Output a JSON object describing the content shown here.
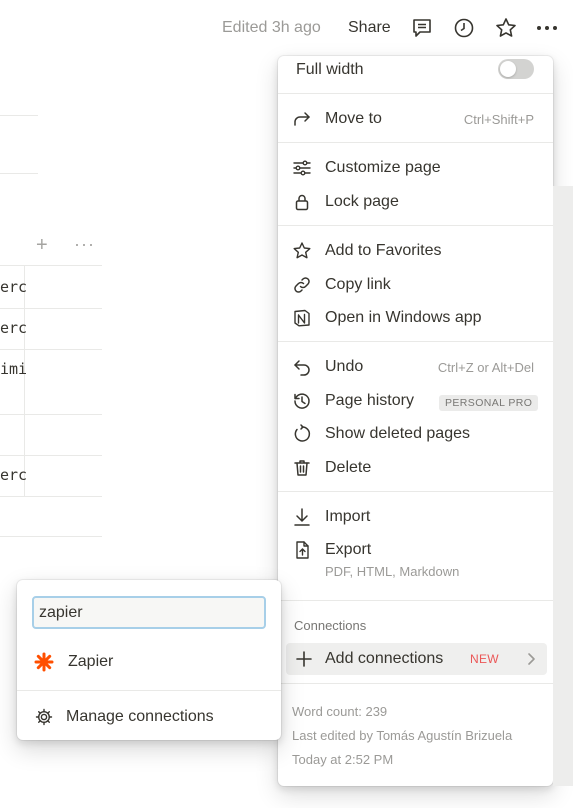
{
  "topbar": {
    "edited": "Edited 3h ago",
    "share": "Share",
    "icons": [
      "comment-icon",
      "clock-icon",
      "star-icon",
      "more-icon"
    ]
  },
  "background": {
    "cell_fragments": [
      "erc",
      "erc",
      "imi",
      "erc"
    ]
  },
  "menu": {
    "full_width": {
      "label": "Full width",
      "enabled": false
    },
    "move_to": {
      "label": "Move to",
      "shortcut": "Ctrl+Shift+P"
    },
    "customize_page": {
      "label": "Customize page"
    },
    "lock_page": {
      "label": "Lock page"
    },
    "add_favorites": {
      "label": "Add to Favorites"
    },
    "copy_link": {
      "label": "Copy link"
    },
    "open_windows": {
      "label": "Open in Windows app"
    },
    "undo": {
      "label": "Undo",
      "shortcut": "Ctrl+Z or Alt+Del"
    },
    "page_history": {
      "label": "Page history",
      "badge": "PERSONAL PRO"
    },
    "show_deleted": {
      "label": "Show deleted pages"
    },
    "delete": {
      "label": "Delete"
    },
    "import": {
      "label": "Import"
    },
    "export": {
      "label": "Export",
      "subtitle": "PDF, HTML, Markdown"
    },
    "connections": {
      "title": "Connections",
      "add_label": "Add connections",
      "new_badge": "NEW"
    },
    "footer": {
      "word_count": "Word count: 239",
      "last_edited_by": "Last edited by Tomás Agustín Brizuela",
      "last_edited_time": "Today at 2:52 PM"
    }
  },
  "popup": {
    "search_value": "zapier",
    "results": [
      {
        "label": "Zapier",
        "icon": "zapier-icon"
      }
    ],
    "manage_label": "Manage connections"
  },
  "colors": {
    "accent_red": "#eb5757",
    "zapier_orange": "#ff4f00",
    "focus_ring": "#a7cfe8"
  }
}
